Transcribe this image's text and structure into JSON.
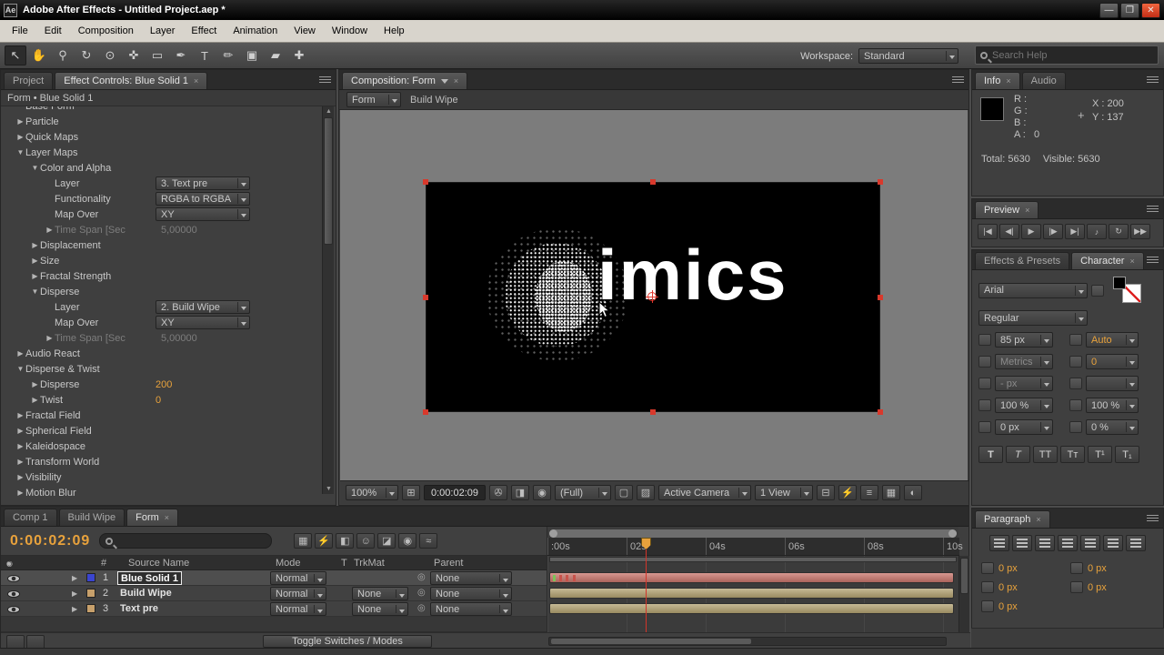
{
  "icons": {
    "minimize": "—",
    "maximize": "❐",
    "close": "✕",
    "tab_close": "×",
    "crosshair": "+",
    "pickwhip": "◎",
    "twirl": "▶"
  },
  "titlebar": {
    "app_initials": "Ae",
    "title": "Adobe After Effects - Untitled Project.aep *"
  },
  "menubar": {
    "items": [
      "File",
      "Edit",
      "Composition",
      "Layer",
      "Effect",
      "Animation",
      "View",
      "Window",
      "Help"
    ]
  },
  "toolbar": {
    "tools": [
      {
        "name": "selection-tool",
        "glyph": "↖",
        "cls": "sel"
      },
      {
        "name": "hand-tool",
        "glyph": "✋",
        "cls": ""
      },
      {
        "name": "zoom-tool",
        "glyph": "⚲",
        "cls": ""
      },
      {
        "name": "rotation-tool",
        "glyph": "↻",
        "cls": ""
      },
      {
        "name": "unified-camera-tool",
        "glyph": "⊙",
        "cls": ""
      },
      {
        "name": "pan-behind-tool",
        "glyph": "✜",
        "cls": ""
      },
      {
        "name": "shape-tool",
        "glyph": "▭",
        "cls": ""
      },
      {
        "name": "pen-tool",
        "glyph": "✒",
        "cls": ""
      },
      {
        "name": "type-tool",
        "glyph": "T",
        "cls": ""
      },
      {
        "name": "brush-tool",
        "glyph": "✏",
        "cls": ""
      },
      {
        "name": "clone-stamp-tool",
        "glyph": "▣",
        "cls": ""
      },
      {
        "name": "eraser-tool",
        "glyph": "▰",
        "cls": ""
      },
      {
        "name": "puppet-pin-tool",
        "glyph": "✚",
        "cls": ""
      }
    ],
    "workspace_label": "Workspace:",
    "workspace_value": "Standard",
    "search_placeholder": "Search Help"
  },
  "effect_controls": {
    "tabs": [
      {
        "label": "Project",
        "cls": ""
      },
      {
        "label": "Effect Controls: Blue Solid 1",
        "cls": "active"
      }
    ],
    "panel_header": "Form • Blue Solid 1",
    "rows": [
      {
        "arrow": "",
        "label": "Base Form",
        "cls": "i0 cut",
        "value": "",
        "vcls": ""
      },
      {
        "arrow": "▶",
        "label": "Particle",
        "cls": "i0",
        "value": "",
        "vcls": ""
      },
      {
        "arrow": "▶",
        "label": "Quick Maps",
        "cls": "i0",
        "value": "",
        "vcls": ""
      },
      {
        "arrow": "▼",
        "label": "Layer Maps",
        "cls": "i0",
        "value": "",
        "vcls": ""
      },
      {
        "arrow": "▼",
        "label": "Color and Alpha",
        "cls": "i1",
        "value": "",
        "vcls": ""
      },
      {
        "arrow": "",
        "label": "Layer",
        "cls": "i2",
        "value": "3. Text pre",
        "vcls": "vdd"
      },
      {
        "arrow": "",
        "label": "Functionality",
        "cls": "i2",
        "value": "RGBA to RGBA",
        "vcls": "vdd"
      },
      {
        "arrow": "",
        "label": "Map Over",
        "cls": "i2",
        "value": "XY",
        "vcls": "vdd"
      },
      {
        "arrow": "▶",
        "label": "Time Span [Sec",
        "cls": "i2 dim",
        "value": "5,00000",
        "vcls": "vdim"
      },
      {
        "arrow": "▶",
        "label": "Displacement",
        "cls": "i1",
        "value": "",
        "vcls": ""
      },
      {
        "arrow": "▶",
        "label": "Size",
        "cls": "i1",
        "value": "",
        "vcls": ""
      },
      {
        "arrow": "▶",
        "label": "Fractal Strength",
        "cls": "i1",
        "value": "",
        "vcls": ""
      },
      {
        "arrow": "▼",
        "label": "Disperse",
        "cls": "i1",
        "value": "",
        "vcls": ""
      },
      {
        "arrow": "",
        "label": "Layer",
        "cls": "i2",
        "value": "2. Build Wipe",
        "vcls": "vdd"
      },
      {
        "arrow": "",
        "label": "Map Over",
        "cls": "i2",
        "value": "XY",
        "vcls": "vdd"
      },
      {
        "arrow": "▶",
        "label": "Time Span [Sec",
        "cls": "i2 dim",
        "value": "5,00000",
        "vcls": "vdim"
      },
      {
        "arrow": "▶",
        "label": "Audio React",
        "cls": "i0",
        "value": "",
        "vcls": ""
      },
      {
        "arrow": "▼",
        "label": "Disperse & Twist",
        "cls": "i0",
        "value": "",
        "vcls": ""
      },
      {
        "arrow": "▶",
        "label": "Disperse",
        "cls": "i1",
        "value": "200",
        "vcls": "vnum"
      },
      {
        "arrow": "▶",
        "label": "Twist",
        "cls": "i1",
        "value": "0",
        "vcls": "vnum"
      },
      {
        "arrow": "▶",
        "label": "Fractal Field",
        "cls": "i0",
        "value": "",
        "vcls": ""
      },
      {
        "arrow": "▶",
        "label": "Spherical Field",
        "cls": "i0",
        "value": "",
        "vcls": ""
      },
      {
        "arrow": "▶",
        "label": "Kaleidospace",
        "cls": "i0",
        "value": "",
        "vcls": ""
      },
      {
        "arrow": "▶",
        "label": "Transform World",
        "cls": "i0",
        "value": "",
        "vcls": ""
      },
      {
        "arrow": "▶",
        "label": "Visibility",
        "cls": "i0",
        "value": "",
        "vcls": ""
      },
      {
        "arrow": "▶",
        "label": "Motion Blur",
        "cls": "i0",
        "value": "",
        "vcls": ""
      }
    ]
  },
  "composition": {
    "tab_label": "Composition: Form",
    "view_main": "Form",
    "view_secondary": "Build Wipe",
    "text": "imics",
    "zoom": "100%",
    "timecode": "0:00:02:09",
    "resolution": "(Full)",
    "camera": "Active Camera",
    "view_layout": "1 View",
    "icons1": [
      {
        "name": "grid-and-guides-icon",
        "glyph": "⊞"
      }
    ],
    "icons2": [
      {
        "name": "snapshot-icon",
        "glyph": "✇"
      },
      {
        "name": "show-last-snapshot-icon",
        "glyph": "◨"
      },
      {
        "name": "show-channel-icon",
        "glyph": "◉"
      }
    ],
    "icons3": [
      {
        "name": "region-of-interest-icon",
        "glyph": "▢"
      },
      {
        "name": "transparency-grid-icon",
        "glyph": "▨"
      }
    ],
    "icons4": [
      {
        "name": "pixel-aspect-correction-icon",
        "glyph": "⊟"
      },
      {
        "name": "fast-previews-icon",
        "glyph": "⚡"
      },
      {
        "name": "timeline-button-icon",
        "glyph": "≡"
      },
      {
        "name": "comp-flowchart-icon",
        "glyph": "▦"
      },
      {
        "name": "exposure-icon",
        "glyph": "◐"
      }
    ]
  },
  "info": {
    "tabs": [
      {
        "label": "Info",
        "cls": "active"
      },
      {
        "label": "Audio",
        "cls": ""
      }
    ],
    "channels": [
      {
        "label": "R :",
        "value": ""
      },
      {
        "label": "G :",
        "value": ""
      },
      {
        "label": "B :",
        "value": ""
      },
      {
        "label": "A :",
        "value": "0"
      }
    ],
    "x": "X : 200",
    "y": "Y : 137",
    "total": "Total: 5630",
    "visible": "Visible: 5630"
  },
  "preview": {
    "tab_label": "Preview",
    "buttons": [
      {
        "name": "first-frame-button",
        "glyph": "|◀"
      },
      {
        "name": "previous-frame-button",
        "glyph": "◀|"
      },
      {
        "name": "play-button",
        "glyph": "▶"
      },
      {
        "name": "next-frame-button",
        "glyph": "|▶"
      },
      {
        "name": "last-frame-button",
        "glyph": "▶|"
      },
      {
        "name": "audio-toggle-button",
        "glyph": "♪"
      },
      {
        "name": "loop-button",
        "glyph": "↻"
      },
      {
        "name": "ram-preview-button",
        "glyph": "▶▶"
      }
    ]
  },
  "character": {
    "tabs": [
      {
        "label": "Effects & Presets",
        "cls": ""
      },
      {
        "label": "Character",
        "cls": "active"
      }
    ],
    "font_family": "Arial",
    "font_style": "Regular",
    "font_size": "85 px",
    "leading": "Auto",
    "kerning": "Metrics",
    "kerning_value": "0",
    "tracking": "- px",
    "vertical_scale": "100 %",
    "horizontal_scale": "100 %",
    "baseline_shift": "0 px",
    "tsume": "0 %",
    "faux": [
      {
        "glyph": "T",
        "cls": "b"
      },
      {
        "glyph": "T",
        "cls": "i"
      },
      {
        "glyph": "TT",
        "cls": ""
      },
      {
        "glyph": "Tт",
        "cls": ""
      },
      {
        "glyph": "T¹",
        "cls": ""
      },
      {
        "glyph": "T₁",
        "cls": ""
      }
    ]
  },
  "paragraph": {
    "tab_label": "Paragraph",
    "fields": [
      "0 px",
      "0 px",
      "0 px",
      "0 px",
      "0 px"
    ]
  },
  "timeline": {
    "tabs": [
      {
        "label": "Comp 1",
        "cls": ""
      },
      {
        "label": "Build Wipe",
        "cls": ""
      },
      {
        "label": "Form",
        "cls": "active"
      }
    ],
    "timecode": "0:00:02:09",
    "icons": [
      {
        "name": "composition-mini-flowchart-icon",
        "glyph": "▦"
      },
      {
        "name": "live-update-icon",
        "glyph": "⚡"
      },
      {
        "name": "draft-3d-icon",
        "glyph": "◧"
      },
      {
        "name": "hide-shy-layers-icon",
        "glyph": "☺"
      },
      {
        "name": "frame-blend-icon",
        "glyph": "◪"
      },
      {
        "name": "motion-blur-icon",
        "glyph": "◉"
      },
      {
        "name": "graph-editor-icon",
        "glyph": "≈"
      }
    ],
    "header_icons": [
      {
        "name": "eye-column-icon",
        "glyph": "◉"
      },
      {
        "name": "audio-column-icon",
        "glyph": "♪"
      },
      {
        "name": "solo-column-icon",
        "glyph": "●"
      },
      {
        "name": "lock-column-icon",
        "glyph": "▪"
      }
    ],
    "columns": {
      "num": "#",
      "source": "Source Name",
      "mode": "Mode",
      "t": "T",
      "trkmat": "TrkMat",
      "parent": "Parent"
    },
    "layers": [
      {
        "num": "1",
        "name": "Blue Solid 1",
        "mode": "Normal",
        "trkmat": "",
        "parent": "None",
        "color": "#3a45cf",
        "bar": "#c9756b",
        "cls": "selected",
        "tm_cls": "hide"
      },
      {
        "num": "2",
        "name": "Build Wipe",
        "mode": "Normal",
        "trkmat": "None",
        "parent": "None",
        "color": "#c7a06b",
        "bar": "#b3a271",
        "cls": "",
        "tm_cls": ""
      },
      {
        "num": "3",
        "name": "Text pre",
        "mode": "Normal",
        "trkmat": "None",
        "parent": "None",
        "color": "#c7a06b",
        "bar": "#b3a271",
        "cls": "",
        "tm_cls": ""
      }
    ],
    "ruler": [
      ":00s",
      "02s",
      "04s",
      "06s",
      "08s",
      "10s"
    ],
    "toggle_button": "Toggle Switches / Modes"
  }
}
